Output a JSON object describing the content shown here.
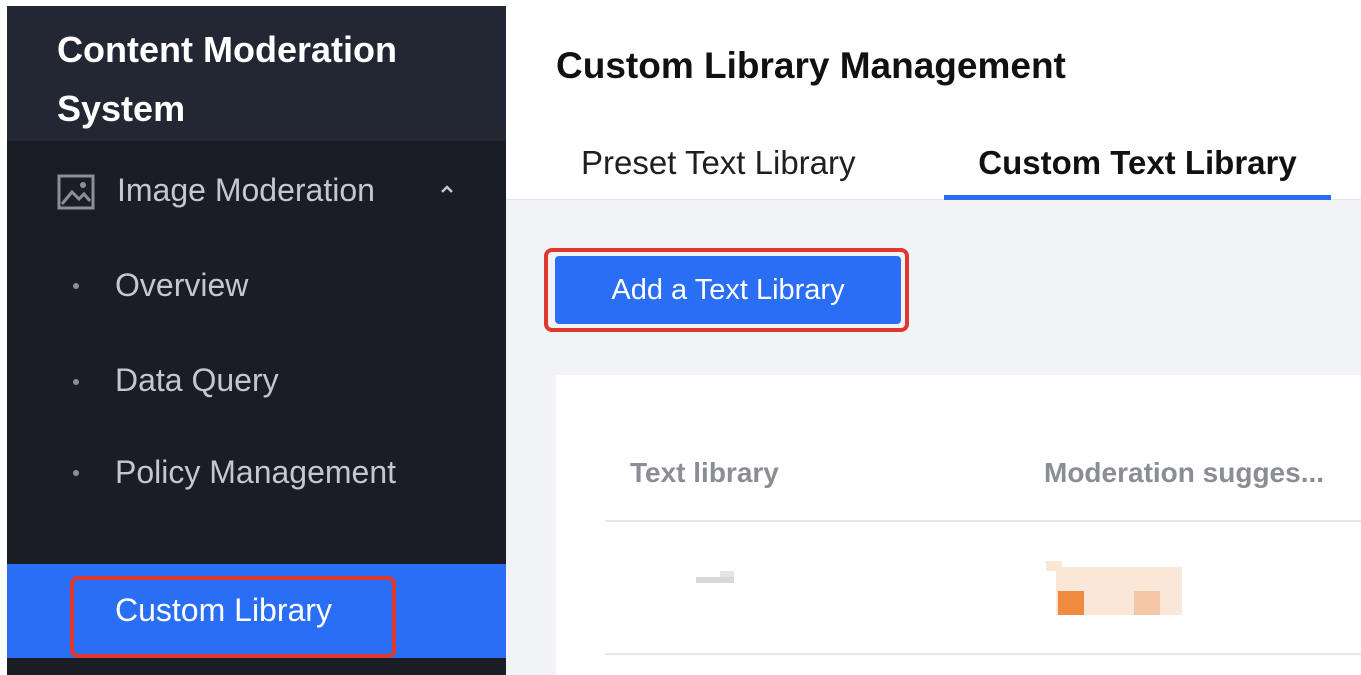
{
  "sidebar": {
    "app_title": "Content Moderation System",
    "group": {
      "label": "Image Moderation",
      "icon": "image-icon",
      "chevron": "chevron-up-icon"
    },
    "items": [
      {
        "label": "Overview",
        "active": false
      },
      {
        "label": "Data Query",
        "active": false
      },
      {
        "label": "Policy Management",
        "active": false
      },
      {
        "label": "Custom Library",
        "active": true
      }
    ]
  },
  "main": {
    "page_title": "Custom Library Management",
    "tabs": [
      {
        "label": "Preset Text Library",
        "active": false
      },
      {
        "label": "Custom Text Library",
        "active": true
      }
    ],
    "add_button_label": "Add a Text Library",
    "table": {
      "columns": [
        "Text library",
        "Moderation sugges..."
      ]
    }
  },
  "colors": {
    "accent": "#2a6ef5",
    "sidebar_bg": "#1a1d24",
    "highlight": "#e0382e",
    "tag_orange": "#ef8a3e"
  }
}
